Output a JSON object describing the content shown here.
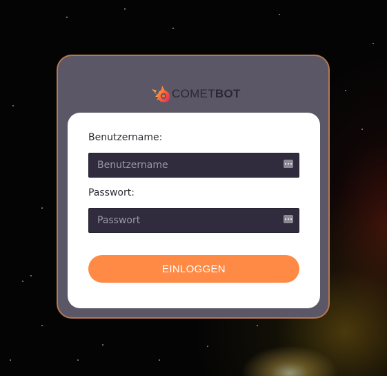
{
  "brand": {
    "logo_text_light": "COMET",
    "logo_text_bold": "BOT",
    "logo_icon": "comet-flame-icon"
  },
  "login_form": {
    "username_label": "Benutzername:",
    "username_placeholder": "Benutzername",
    "username_value": "",
    "password_label": "Passwort:",
    "password_placeholder": "Passwort",
    "password_value": "",
    "password_manager_icon": "password-manager-icon",
    "submit_label": "EINLOGGEN"
  },
  "colors": {
    "accent": "#ff8a45",
    "card_background": "#5c5766",
    "card_border": "#b87850",
    "input_background": "#302c3e",
    "form_background": "#ffffff"
  }
}
